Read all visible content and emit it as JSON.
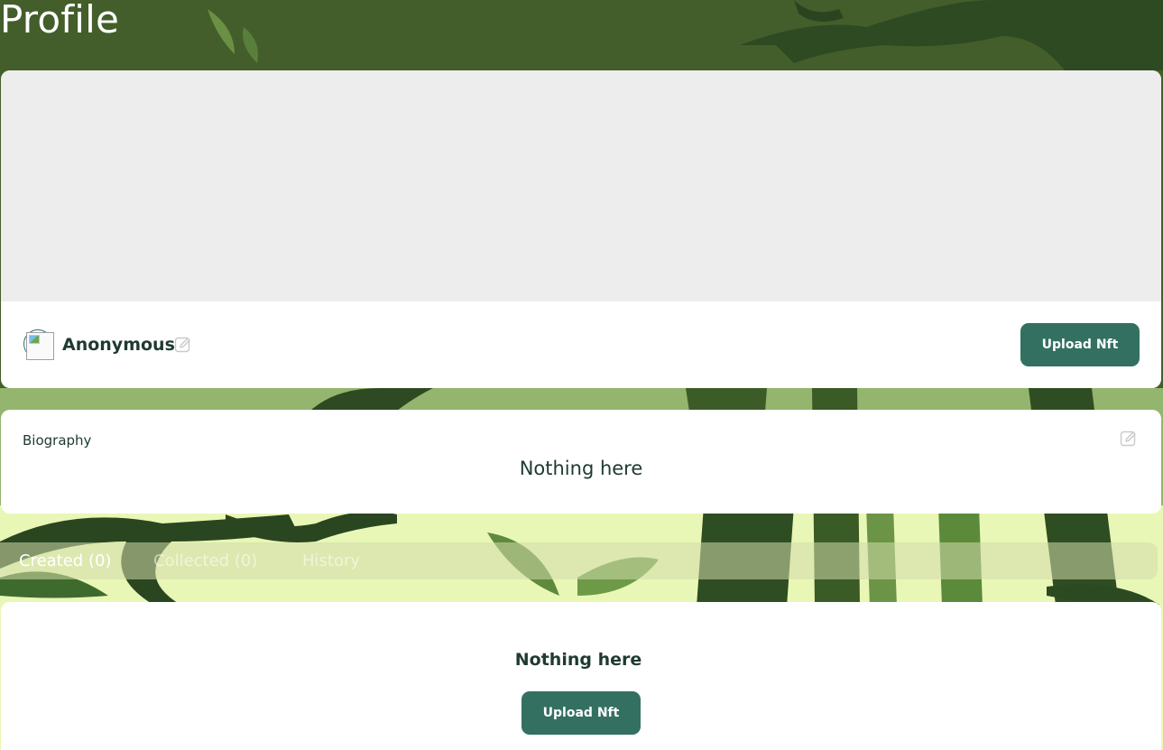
{
  "page": {
    "title": "Profile"
  },
  "profile": {
    "username": "Anonymous",
    "upload_button_label": "Upload Nft"
  },
  "biography": {
    "label": "Biography",
    "empty_text": "Nothing here"
  },
  "tabs": [
    {
      "label": "Created (0)",
      "active": true
    },
    {
      "label": "Collected (0)",
      "active": false
    },
    {
      "label": "History",
      "active": false
    }
  ],
  "content": {
    "empty_text": "Nothing here",
    "upload_button_label": "Upload Nft"
  },
  "icons": {
    "edit": "pencil-square-icon",
    "avatar": "broken-image-icon"
  },
  "colors": {
    "accent": "#347062",
    "text": "#1f3a33",
    "banner": "#ededed",
    "background": "#3f5f2a"
  }
}
